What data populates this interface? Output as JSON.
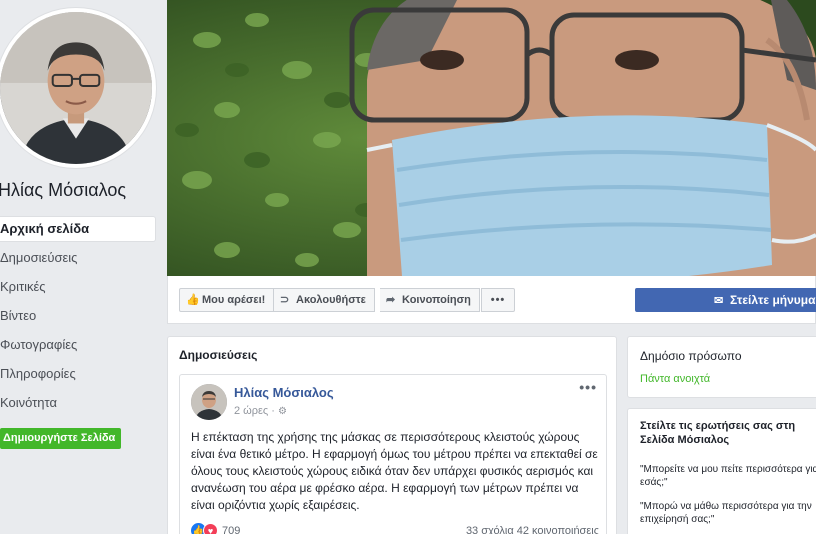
{
  "page": {
    "name": "Ηλίας Μόσιαλος"
  },
  "nav": {
    "items": [
      {
        "label": "Αρχική σελίδα"
      },
      {
        "label": "Δημοσιεύσεις"
      },
      {
        "label": "Κριτικές"
      },
      {
        "label": "Βίντεο"
      },
      {
        "label": "Φωτογραφίες"
      },
      {
        "label": "Πληροφορίες"
      },
      {
        "label": "Κοινότητα"
      }
    ],
    "create_page": "Δημιουργήστε Σελίδα"
  },
  "actions": {
    "like": "Μου αρέσει!",
    "follow": "Ακολουθήστε",
    "share": "Κοινοποίηση",
    "more": "•••",
    "message": "Στείλτε μήνυμα"
  },
  "posts": {
    "title": "Δημοσιεύσεις",
    "post": {
      "author": "Ηλίας Μόσιαλος",
      "time": "2 ώρες ·",
      "menu": "•••",
      "text": "Η επέκταση της χρήσης της μάσκας σε περισσότερους κλειστούς χώρους είναι ένα θετικό μέτρο. Η εφαρμογή όμως του μέτρου πρέπει να επεκταθεί σε όλους τους κλειστούς χώρους ειδικά όταν δεν υπάρχει φυσικός αερισμός και ανανέωση του αέρα με φρέσκο αέρα. Η εφαρμογή των μέτρων πρέπει να είναι οριζόντια χωρίς εξαιρέσεις.",
      "reactions_count": "709",
      "stats": "33 σχόλια  42 κοινοποιήσεις"
    }
  },
  "info": {
    "title": "Δημόσιο πρόσωπο",
    "status": "Πάντα ανοιχτά"
  },
  "ask": {
    "title": "Στείλτε τις ερωτήσεις σας στη Σελίδα Μόσιαλος",
    "q1": "\"Μπορείτε να μου πείτε περισσότερα για εσάς;\"",
    "q2": "\"Μπορώ να μάθω περισσότερα για την επιχείρησή σας;\""
  },
  "colors": {
    "brand": "#4267b2",
    "link": "#365899",
    "green": "#42b72a"
  }
}
